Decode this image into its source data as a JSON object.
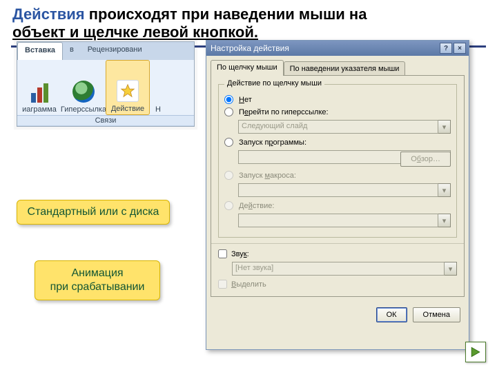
{
  "title": {
    "accent": "Действия",
    "rest1": " происходят при наведении мыши на ",
    "underlined": "объект и щелчке левой кнопкой."
  },
  "ribbon": {
    "tabs": {
      "active": "Вставка",
      "t2": "в",
      "t3": "Рецензировани"
    },
    "buttons": {
      "chart": "иаграмма",
      "link": "Гиперссылка",
      "action": "Действие",
      "next": "Н"
    },
    "groupLabel": "Связи"
  },
  "callouts": {
    "c1": "Стандартный или с диска",
    "c2_l1": "Анимация",
    "c2_l2": "при срабатывании"
  },
  "dialog": {
    "title": "Настройка действия",
    "helpIcon": "?",
    "closeIcon": "×",
    "tab1": "По щелчку мыши",
    "tab2": "По наведении указателя мыши",
    "groupLegend": "Действие по щелчку мыши",
    "radio_none_pre": "",
    "radio_none_u": "Н",
    "radio_none_post": "ет",
    "radio_hyper_pre": "П",
    "radio_hyper_u": "е",
    "radio_hyper_post": "рейти по гиперссылке:",
    "combo_hyper": "Следующий слайд",
    "radio_prog_pre": "Запуск п",
    "radio_prog_u": "р",
    "radio_prog_post": "ограммы:",
    "browse_pre": "О",
    "browse_u": "б",
    "browse_post": "зор…",
    "radio_macro_pre": "Запуск ",
    "radio_macro_u": "м",
    "radio_macro_post": "акроса:",
    "radio_action_pre": "Де",
    "radio_action_u": "й",
    "radio_action_post": "ствие:",
    "check_sound_pre": "Зву",
    "check_sound_u": "к",
    "check_sound_post": ":",
    "combo_sound": "[Нет звука]",
    "check_highlight_pre": "",
    "check_highlight_u": "В",
    "check_highlight_post": "ыделить",
    "ok": "ОК",
    "cancel": "Отмена"
  }
}
